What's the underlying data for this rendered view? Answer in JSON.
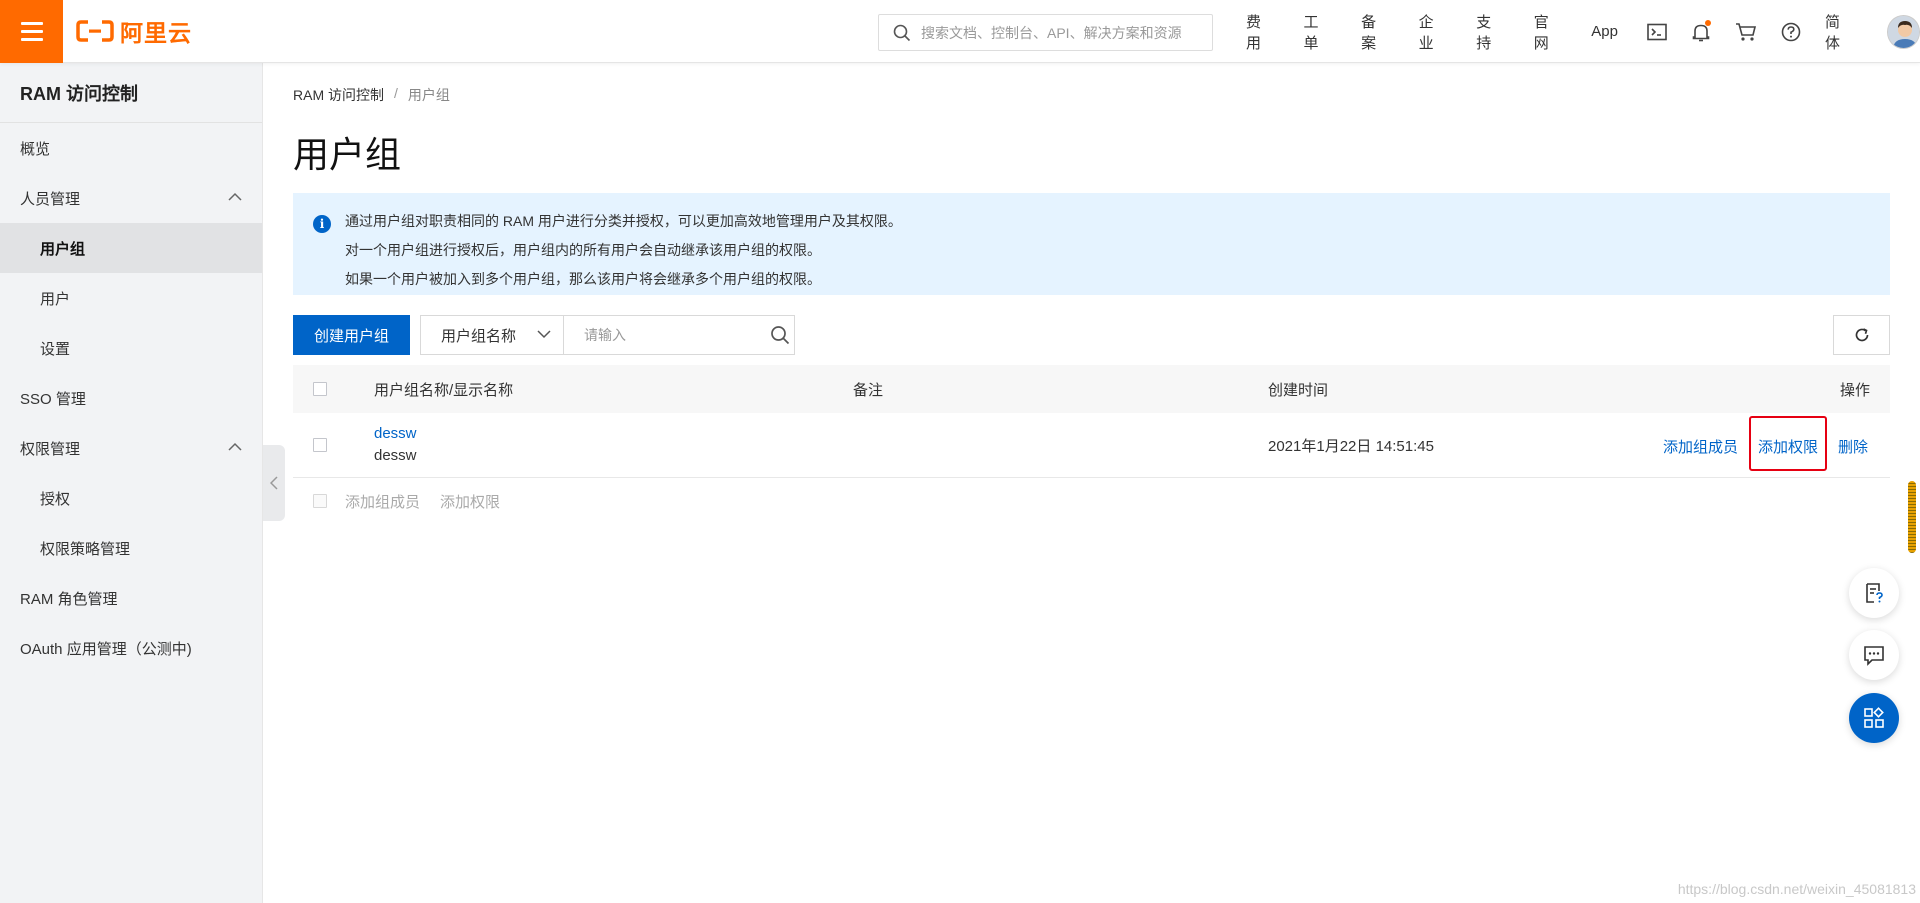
{
  "header": {
    "logo_text": "阿里云",
    "search_placeholder": "搜索文档、控制台、API、解决方案和资源",
    "nav_links": [
      "费用",
      "工单",
      "备案",
      "企业",
      "支持",
      "官网",
      "App"
    ],
    "lang": "简体",
    "icons": [
      "terminal-icon",
      "bell-icon",
      "cart-icon",
      "help-icon"
    ],
    "brand_color": "#ff6a00"
  },
  "sidebar": {
    "title": "RAM 访问控制",
    "items": [
      {
        "label": "概览"
      },
      {
        "label": "人员管理"
      },
      {
        "label": "用户组"
      },
      {
        "label": "用户"
      },
      {
        "label": "设置"
      },
      {
        "label": "SSO 管理"
      },
      {
        "label": "权限管理"
      },
      {
        "label": "授权"
      },
      {
        "label": "权限策略管理"
      },
      {
        "label": "RAM 角色管理"
      },
      {
        "label": "OAuth 应用管理（公测中)"
      }
    ]
  },
  "breadcrumb": {
    "root": "RAM 访问控制",
    "separator": "/",
    "current": "用户组"
  },
  "page_title": "用户组",
  "info": {
    "icon_glyph": "i",
    "lines": [
      "通过用户组对职责相同的 RAM 用户进行分类并授权，可以更加高效地管理用户及其权限。",
      "对一个用户组进行授权后，用户组内的所有用户会自动继承该用户组的权限。",
      "如果一个用户被加入到多个用户组，那么该用户将会继承多个用户组的权限。"
    ]
  },
  "toolbar": {
    "create_label": "创建用户组",
    "filter_field": "用户组名称",
    "filter_placeholder": "请输入"
  },
  "table": {
    "columns": [
      "用户组名称/显示名称",
      "备注",
      "创建时间",
      "操作"
    ],
    "rows": [
      {
        "name": "dessw",
        "display_name": "dessw",
        "remark": "",
        "created": "2021年1月22日 14:51:45",
        "actions": [
          "添加组成员",
          "添加权限",
          "删除"
        ]
      }
    ]
  },
  "batch_actions": [
    "添加组成员",
    "添加权限"
  ],
  "watermark": "https://blog.csdn.net/weixin_45081813",
  "colors": {
    "primary": "#0064c8",
    "info_bg": "#e5f3ff",
    "highlight": "#e60012"
  }
}
